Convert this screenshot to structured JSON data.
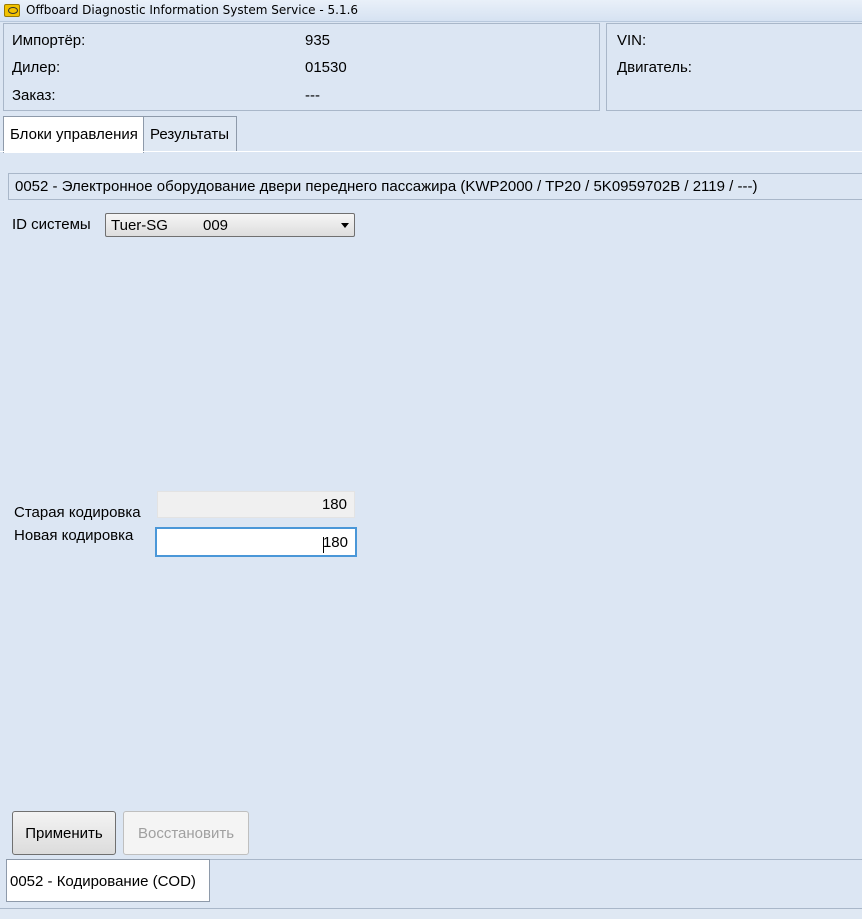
{
  "window": {
    "title": "Offboard Diagnostic Information System Service - 5.1.6",
    "icon": "odis-app-icon"
  },
  "info_left": {
    "importer_label": "Импортёр:",
    "importer_value": "935",
    "dealer_label": "Дилер:",
    "dealer_value": "01530",
    "order_label": "Заказ:",
    "order_value": "---"
  },
  "info_right": {
    "vin_label": "VIN:",
    "engine_label": "Двигатель:"
  },
  "tabs": [
    {
      "label": "Блоки управления",
      "active": true
    },
    {
      "label": "Результаты",
      "active": false
    }
  ],
  "control_unit": {
    "description": "0052 - Электронное оборудование двери переднего пассажира  (KWP2000 / TP20 / 5K0959702B / 2119 / ---)"
  },
  "system_id": {
    "label": "ID системы",
    "selected_name": "Tuer-SG",
    "selected_code": "009"
  },
  "coding": {
    "old_label": "Старая кодировка",
    "old_value": "180",
    "new_label": "Новая кодировка",
    "new_value": "180"
  },
  "buttons": {
    "apply": "Применить",
    "restore": "Восстановить"
  },
  "bottom_tab": {
    "label": "0052 - Кодирование (COD)"
  },
  "colors": {
    "background": "#dce6f3",
    "focus_border": "#4a97d8"
  }
}
